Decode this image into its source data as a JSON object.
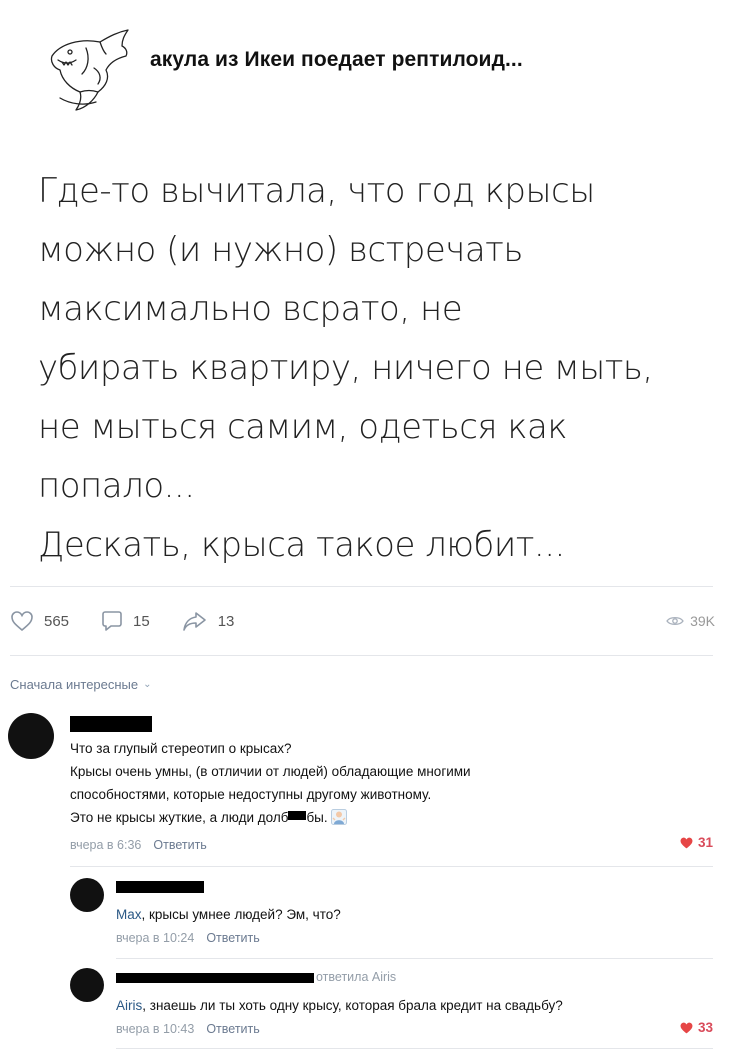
{
  "post": {
    "author": "акула из Икеи поедает рептилоид...",
    "lines": [
      "Где-то вычитала, что год крысы",
      "можно (и нужно) встречать",
      "максимально всрато, не",
      "убирать квартиру, ничего не мыть,",
      "не мыться самим, одеться как",
      "попало...",
      "Дескать, крыса такое любит..."
    ],
    "likes": "565",
    "comments": "15",
    "shares": "13",
    "views": "39K",
    "logo_icon": "shark-sketch-icon"
  },
  "comments_section": {
    "sort_label": "Сначала интересные"
  },
  "comments": [
    {
      "lines": [
        "Что за глупый стереотип о крысах?",
        "Крысы очень умны, (в отличии от людей) обладающие многими",
        "способностями, которые недоступны другому животному.",
        "Это не крысы жуткие, а люди долб",
        "бы."
      ],
      "time": "вчера в 6:36",
      "reply_label": "Ответить",
      "likes": "31"
    },
    {
      "mention": "Max",
      "text": ", крысы умнее людей? Эм, что?",
      "time": "вчера в 10:24",
      "reply_label": "Ответить"
    },
    {
      "replied_to": "ответила Airis",
      "mention": "Airis",
      "text": ", знаешь ли ты хоть одну крысу, которая брала кредит на свадьбу?",
      "time": "вчера в 10:43",
      "reply_label": "Ответить",
      "likes": "33"
    }
  ],
  "colors": {
    "accent_link": "#2a5885",
    "like_red": "#d94b5a",
    "meta_gray": "#939da8"
  }
}
